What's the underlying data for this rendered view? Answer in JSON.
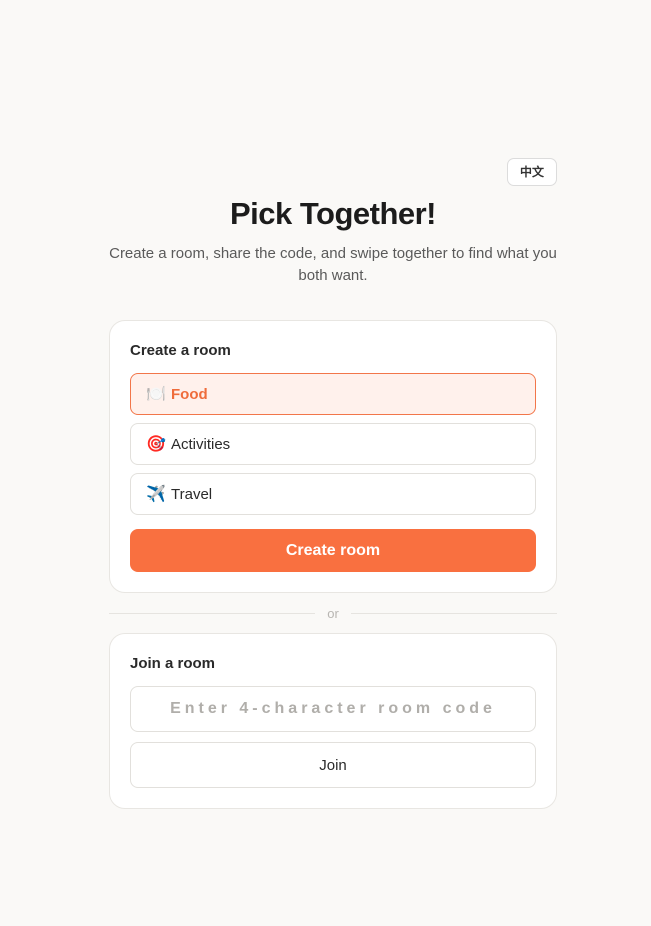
{
  "header": {
    "language_button": "中文",
    "title": "Pick Together!",
    "subtitle": "Create a room, share the code, and swipe together to find what you both want."
  },
  "create_room": {
    "heading": "Create a room",
    "options": [
      {
        "icon": "fork-knife-plate-icon",
        "emoji": "🍽️",
        "label": "Food",
        "selected": true
      },
      {
        "icon": "dart-target-icon",
        "emoji": "🎯",
        "label": "Activities",
        "selected": false
      },
      {
        "icon": "airplane-icon",
        "emoji": "✈️",
        "label": "Travel",
        "selected": false
      }
    ],
    "button_label": "Create room"
  },
  "divider": {
    "label": "or"
  },
  "join_room": {
    "heading": "Join a room",
    "code_placeholder": "Enter 4-character room code",
    "code_value": "",
    "button_label": "Join"
  },
  "colors": {
    "accent": "#f97040",
    "accent_light": "#fff1ec",
    "background": "#faf9f7"
  }
}
